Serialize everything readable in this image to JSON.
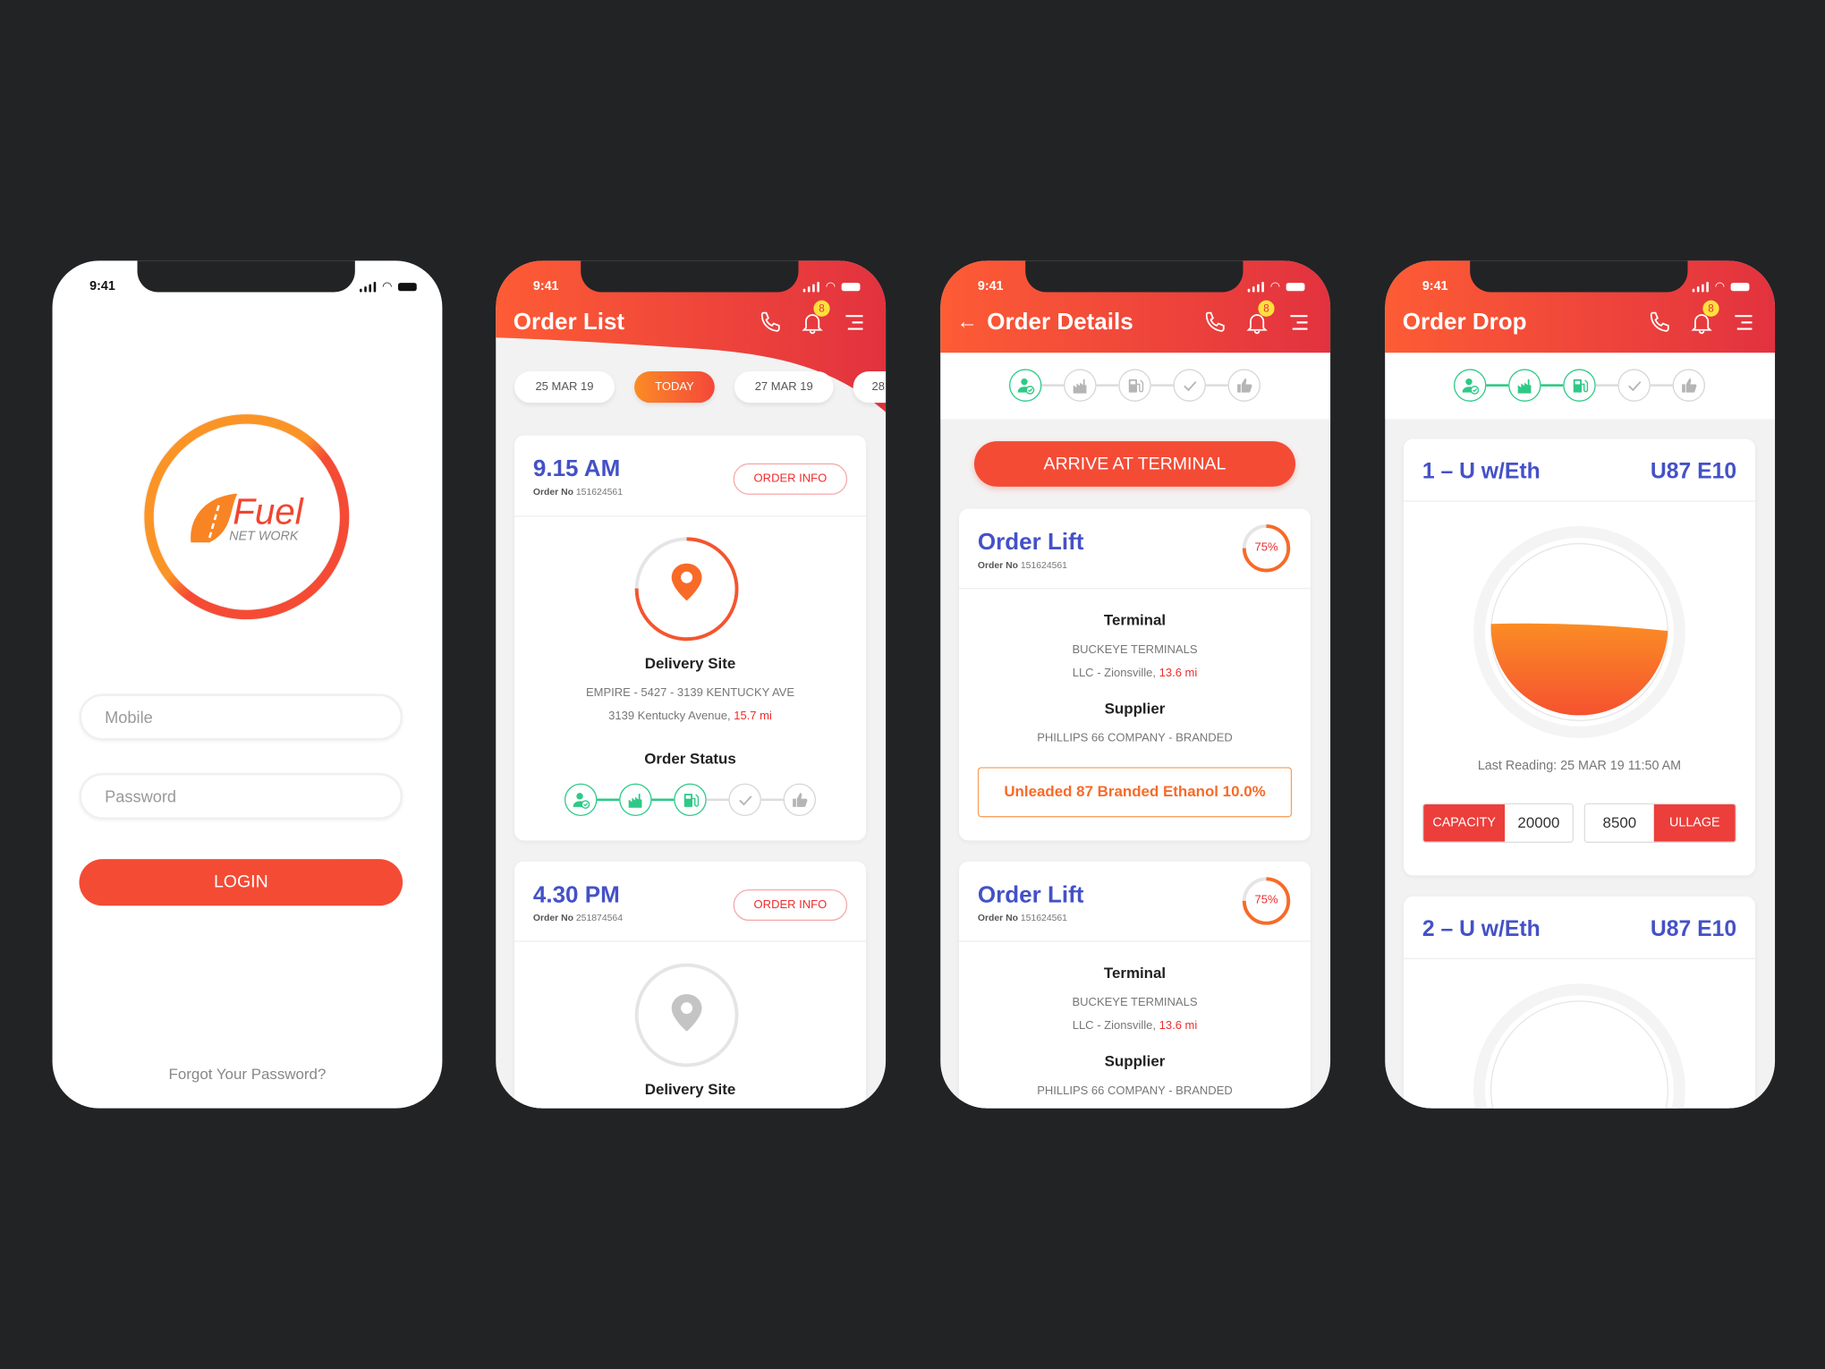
{
  "colors": {
    "accent": "#f44b35",
    "header_start": "#fd5c35",
    "header_end": "#e2323f",
    "title_blue": "#4451c7",
    "done_green": "#2ec986",
    "distance_red": "#ee2c2c",
    "badge_yellow": "#ffe03b"
  },
  "status_bar": {
    "time": "9:41"
  },
  "login": {
    "logo": {
      "brand": "Fuel",
      "sub": "NET WORK"
    },
    "mobile_placeholder": "Mobile",
    "password_placeholder": "Password",
    "login_label": "LOGIN",
    "forgot_label": "Forgot Your Password?"
  },
  "header_icons": [
    "phone-icon",
    "bell-icon",
    "menu-icon"
  ],
  "notification_count": "8",
  "order_list": {
    "title": "Order List",
    "dates": [
      "25 MAR 19",
      "TODAY",
      "27 MAR 19",
      "28"
    ],
    "selected_date": "TODAY",
    "orders": [
      {
        "time": "9.15 AM",
        "order_no_label": "Order No",
        "order_no": "151624561",
        "info_label": "ORDER INFO",
        "site_title": "Delivery Site",
        "site_name": "EMPIRE - 5427 - 3139 KENTUCKY AVE",
        "site_address": "3139 Kentucky Avenue,",
        "distance": "15.7 mi",
        "status_title": "Order Status",
        "steps_done": 3,
        "active": true
      },
      {
        "time": "4.30 PM",
        "order_no_label": "Order No",
        "order_no": "251874564",
        "info_label": "ORDER INFO",
        "site_title": "Delivery Site",
        "active": false
      }
    ]
  },
  "step_icons": [
    "driver-icon",
    "terminal-factory-icon",
    "fuel-pump-icon",
    "check-icon",
    "thumbs-up-icon"
  ],
  "order_details": {
    "title": "Order Details",
    "steps_done": 1,
    "action_label": "ARRIVE AT TERMINAL",
    "lifts": [
      {
        "title": "Order Lift",
        "order_no_label": "Order No",
        "order_no": "151624561",
        "progress": "75%",
        "progress_value": 75,
        "terminal_title": "Terminal",
        "terminal_name": "BUCKEYE TERMINALS",
        "terminal_location": "LLC - Zionsville,",
        "distance": "13.6 mi",
        "supplier_title": "Supplier",
        "supplier_name": "PHILLIPS 66 COMPANY - BRANDED",
        "product": "Unleaded 87 Branded Ethanol 10.0%"
      },
      {
        "title": "Order Lift",
        "order_no_label": "Order No",
        "order_no": "151624561",
        "progress": "75%",
        "progress_value": 75,
        "terminal_title": "Terminal",
        "terminal_name": "BUCKEYE TERMINALS",
        "terminal_location": "LLC - Zionsville,",
        "distance": "13.6 mi",
        "supplier_title": "Supplier",
        "supplier_name": "PHILLIPS 66 COMPANY - BRANDED"
      }
    ]
  },
  "order_drop": {
    "title": "Order Drop",
    "steps_done": 3,
    "tanks": [
      {
        "name": "1 – U w/Eth",
        "code": "U87 E10",
        "level_percent": 52,
        "last_reading": "Last Reading: 25 MAR 19 11:50 AM",
        "capacity_label": "CAPACITY",
        "capacity": "20000",
        "ullage": "8500",
        "ullage_label": "ULLAGE"
      },
      {
        "name": "2 – U w/Eth",
        "code": "U87 E10"
      }
    ]
  }
}
